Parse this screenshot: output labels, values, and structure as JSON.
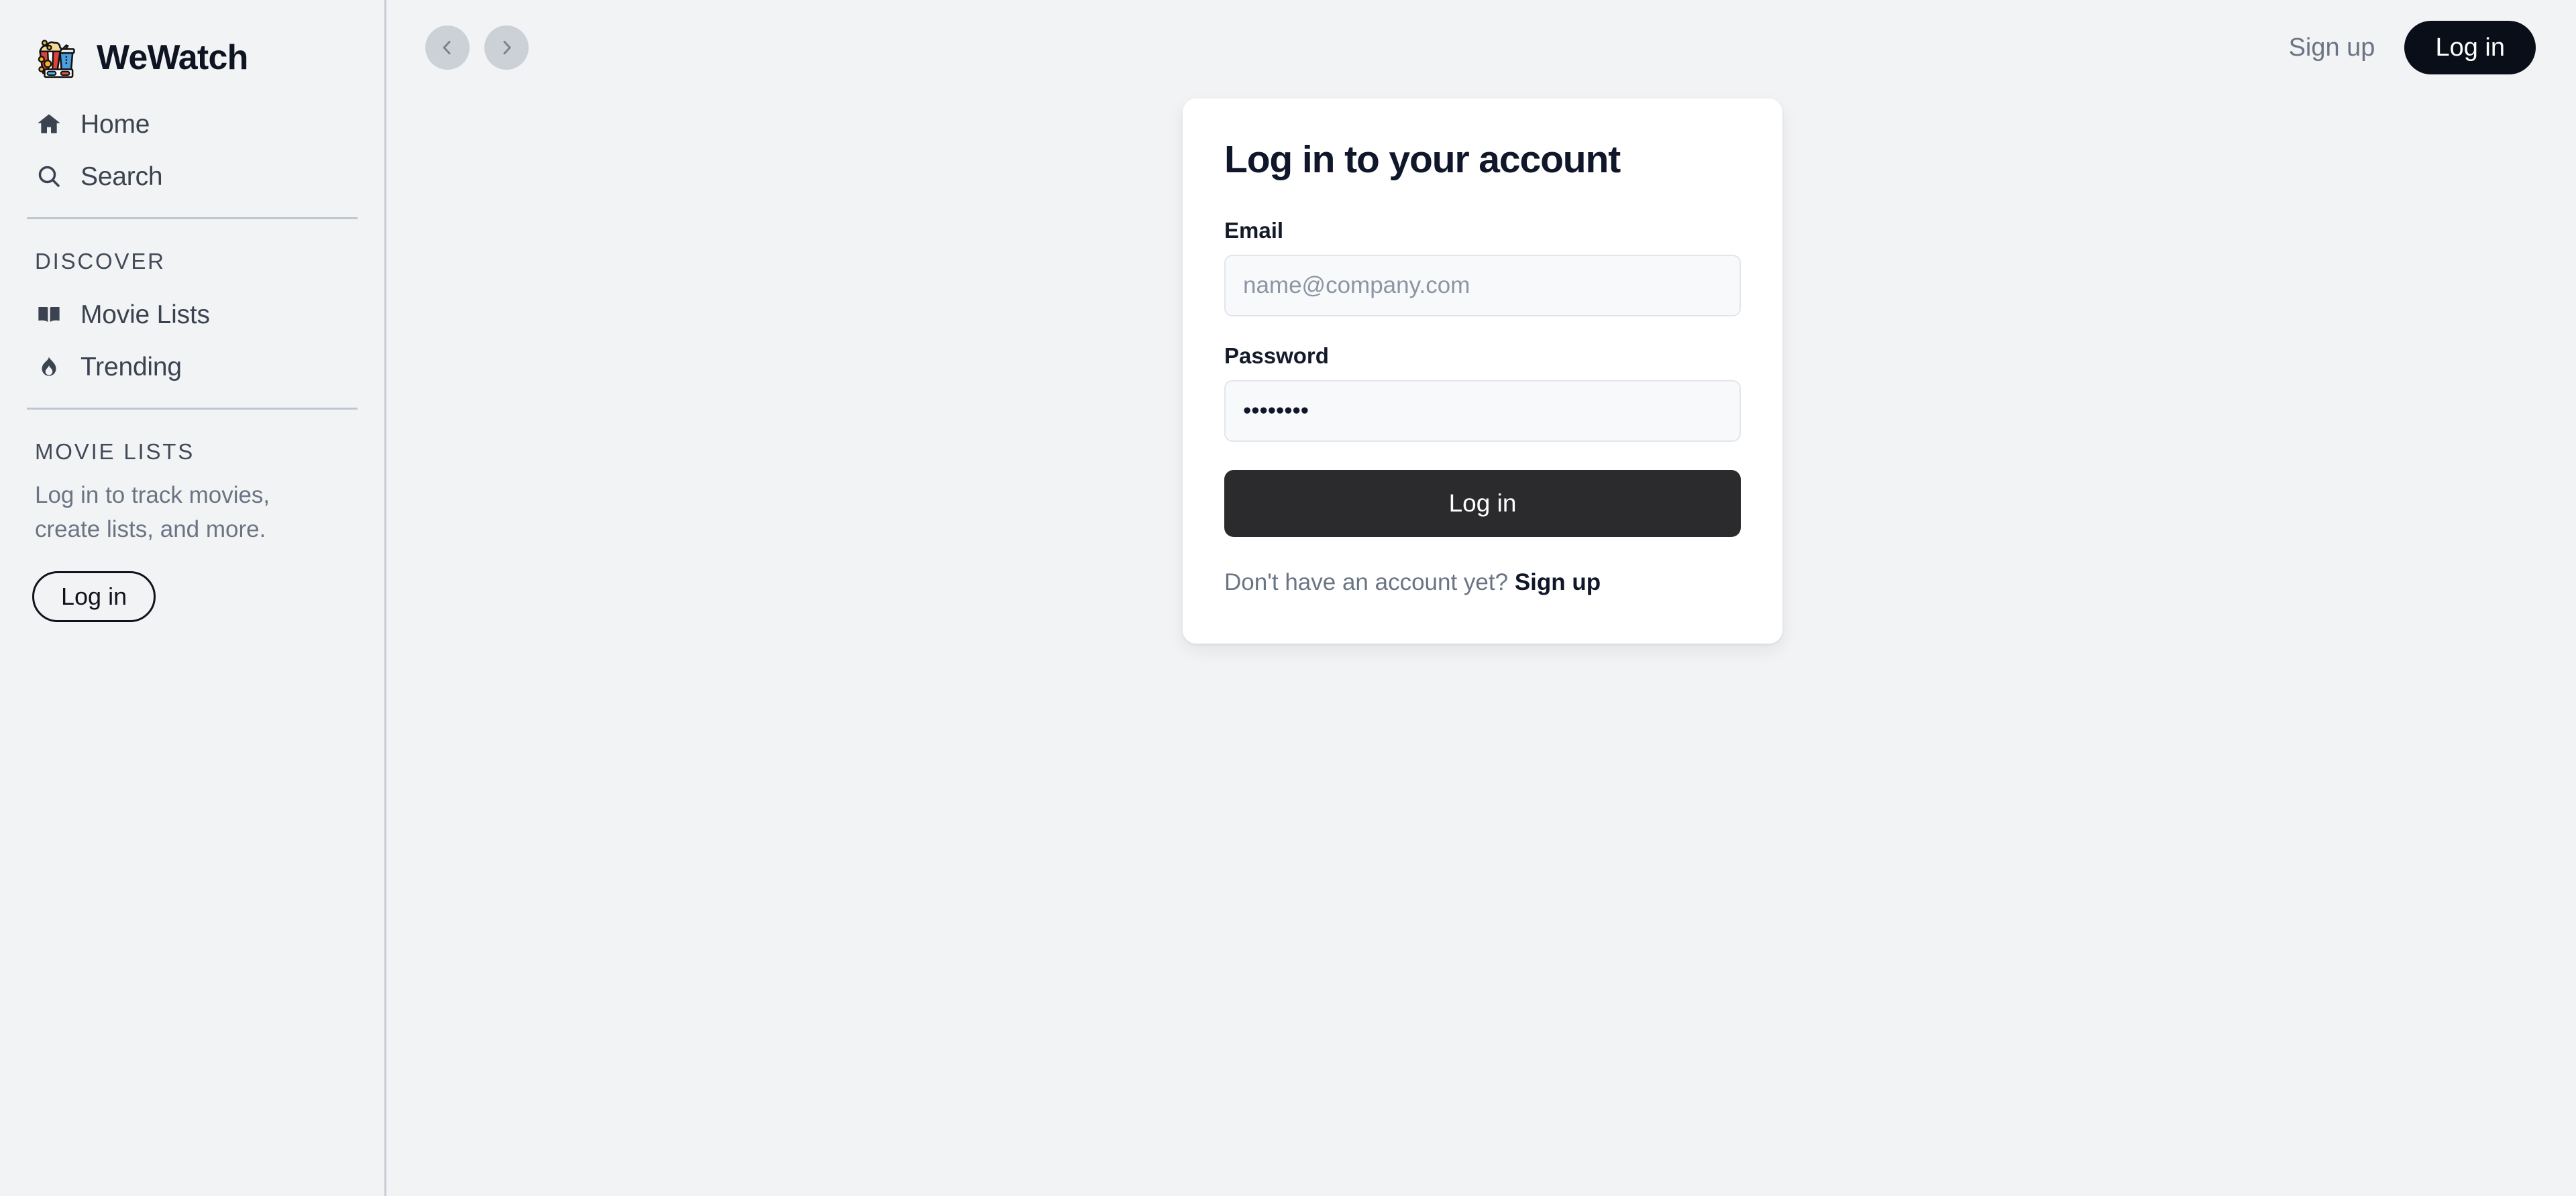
{
  "brand": {
    "name": "WeWatch",
    "logo_icon": "popcorn-cinema-icon"
  },
  "sidebar": {
    "primary_items": [
      {
        "label": "Home",
        "icon": "home-icon"
      },
      {
        "label": "Search",
        "icon": "search-icon"
      }
    ],
    "discover": {
      "section_label": "DISCOVER",
      "items": [
        {
          "label": "Movie Lists",
          "icon": "book-icon"
        },
        {
          "label": "Trending",
          "icon": "flame-icon"
        }
      ]
    },
    "movie_lists": {
      "section_label": "MOVIE LISTS",
      "note": "Log in to track movies, create lists, and more.",
      "login_label": "Log in"
    }
  },
  "topbar": {
    "back_icon": "chevron-left-icon",
    "forward_icon": "chevron-right-icon",
    "signup_label": "Sign up",
    "login_label": "Log in"
  },
  "login_card": {
    "title": "Log in to your account",
    "email": {
      "label": "Email",
      "placeholder": "name@company.com",
      "value": ""
    },
    "password": {
      "label": "Password",
      "placeholder": "",
      "value": "••••••••"
    },
    "submit_label": "Log in",
    "footer_text": "Don't have an account yet?",
    "footer_link_label": "Sign up"
  },
  "colors": {
    "page_background": "#f2f3f5",
    "sidebar_border": "#c8ccd4",
    "nav_text": "#3b4351",
    "heading": "#10172a",
    "muted_text": "#6b7484",
    "primary_button": "#0a0e19",
    "submit_button": "#2b2b2d",
    "input_background": "#f8f9fb",
    "input_border": "#e2e6ec",
    "round_button": "#ccd1d8"
  }
}
